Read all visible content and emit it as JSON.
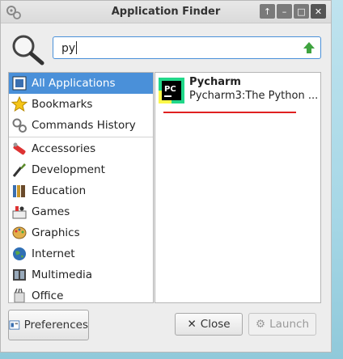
{
  "window": {
    "title": "Application Finder",
    "controls": [
      "arrow-up-icon",
      "minimize-icon",
      "maximize-icon",
      "close-icon"
    ]
  },
  "search": {
    "value": "py"
  },
  "categories": [
    {
      "label": "All Applications",
      "icon": "all-apps-icon",
      "selected": true
    },
    {
      "label": "Bookmarks",
      "icon": "star-icon"
    },
    {
      "label": "Commands History",
      "icon": "gears-icon"
    },
    {
      "label": "Accessories",
      "icon": "accessories-icon"
    },
    {
      "label": "Development",
      "icon": "development-icon"
    },
    {
      "label": "Education",
      "icon": "education-icon"
    },
    {
      "label": "Games",
      "icon": "games-icon"
    },
    {
      "label": "Graphics",
      "icon": "graphics-icon"
    },
    {
      "label": "Internet",
      "icon": "globe-icon"
    },
    {
      "label": "Multimedia",
      "icon": "multimedia-icon"
    },
    {
      "label": "Office",
      "icon": "office-icon"
    }
  ],
  "results": [
    {
      "name": "Pycharm",
      "description": "Pycharm3:The Python ...",
      "icon": "pycharm-icon"
    }
  ],
  "buttons": {
    "preferences": "Preferences",
    "close": "Close",
    "launch": "Launch"
  },
  "colors": {
    "selection": "#4a90d9",
    "annotation": "#e02020"
  }
}
